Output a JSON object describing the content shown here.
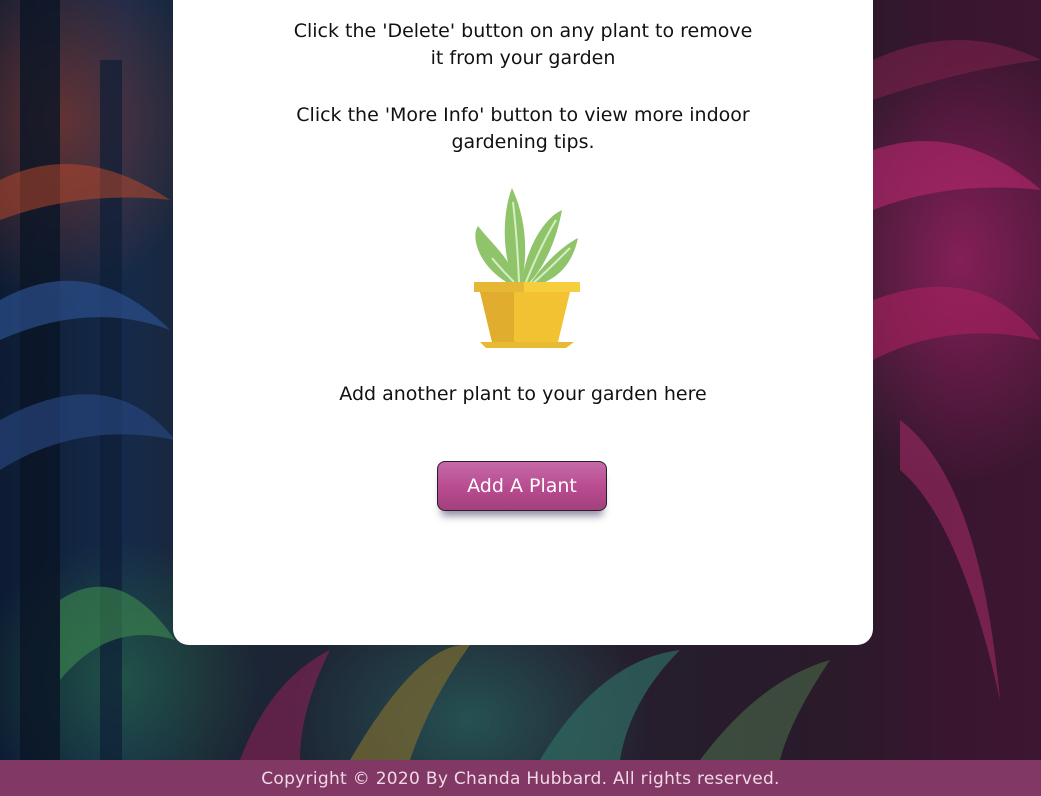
{
  "instructions": {
    "delete_line_1": "Click the 'Delete' button on any plant to remove",
    "delete_line_2": "it from your garden",
    "more_info_line_1": "Click the 'More Info' button to view more indoor",
    "more_info_line_2": "gardening tips."
  },
  "illustration": {
    "icon": "potted-plant-icon"
  },
  "add_section": {
    "prompt": "Add another plant to your garden here",
    "button_label": "Add A Plant"
  },
  "footer": {
    "copyright_text": "Copyright © 2020 By Chanda Hubbard. All rights reserved."
  },
  "colors": {
    "button": "#b84b8f",
    "footer": "#823864",
    "card": "#ffffff",
    "pot": "#f2c232",
    "leaf": "#8fc46a"
  }
}
